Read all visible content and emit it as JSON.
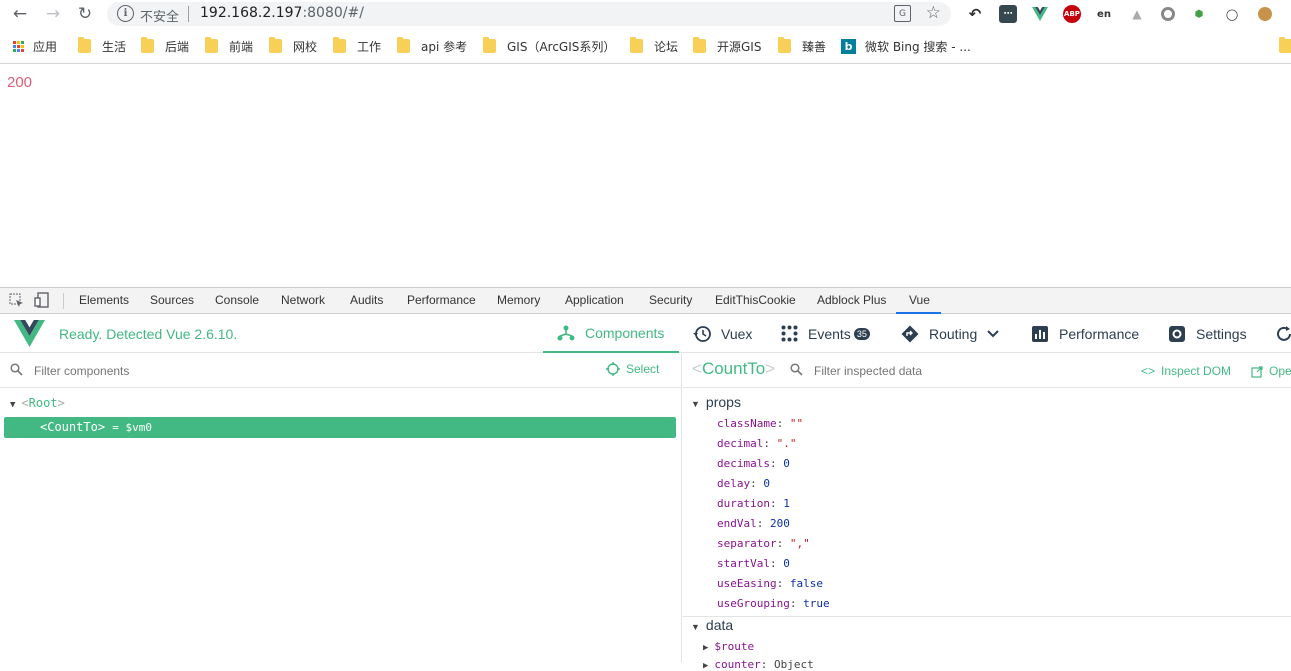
{
  "browser": {
    "security_label": "不安全",
    "url_host": "192.168.2.197",
    "url_rest": ":8080/#/",
    "bookmarks": [
      {
        "label": "应用",
        "kind": "apps"
      },
      {
        "label": "生活",
        "kind": "folder"
      },
      {
        "label": "后端",
        "kind": "folder"
      },
      {
        "label": "前端",
        "kind": "folder"
      },
      {
        "label": "网校",
        "kind": "folder"
      },
      {
        "label": "工作",
        "kind": "folder"
      },
      {
        "label": "api 参考",
        "kind": "folder"
      },
      {
        "label": "GIS（ArcGIS系列）",
        "kind": "folder"
      },
      {
        "label": "论坛",
        "kind": "folder"
      },
      {
        "label": "开源GIS",
        "kind": "folder"
      },
      {
        "label": "臻善",
        "kind": "folder"
      },
      {
        "label": "微软 Bing 搜索 - ...",
        "kind": "bing"
      }
    ],
    "extensions": [
      "undo-icon",
      "grid-icon",
      "vue-icon",
      "abp-icon",
      "en-icon",
      "tree-icon",
      "circle-icon",
      "nodejs-icon",
      "sync-icon",
      "cookie-icon"
    ],
    "ext_abp_text": "ABP"
  },
  "page": {
    "value": "200"
  },
  "devtools": {
    "tabs": [
      "Elements",
      "Sources",
      "Console",
      "Network",
      "Audits",
      "Performance",
      "Memory",
      "Application",
      "Security",
      "EditThisCookie",
      "Adblock Plus",
      "Vue"
    ],
    "active_tab": "Vue"
  },
  "vue": {
    "status": "Ready. Detected Vue 2.6.10.",
    "nav": {
      "components": "Components",
      "vuex": "Vuex",
      "events": "Events",
      "events_badge": "35",
      "routing": "Routing",
      "performance": "Performance",
      "settings": "Settings"
    },
    "filter_components_placeholder": "Filter components",
    "select_label": "Select",
    "tree": {
      "root": "Root",
      "child": "CountTo",
      "child_vm": "= $vm0"
    },
    "inspector": {
      "component_name": "CountTo",
      "filter_placeholder": "Filter inspected data",
      "inspect_dom": "Inspect DOM",
      "open_label": "Ope",
      "props_label": "props",
      "props": [
        {
          "key": "className",
          "value": "\"\"",
          "type": "str"
        },
        {
          "key": "decimal",
          "value": "\".\"",
          "type": "str"
        },
        {
          "key": "decimals",
          "value": "0",
          "type": "num"
        },
        {
          "key": "delay",
          "value": "0",
          "type": "num"
        },
        {
          "key": "duration",
          "value": "1",
          "type": "num"
        },
        {
          "key": "endVal",
          "value": "200",
          "type": "num"
        },
        {
          "key": "separator",
          "value": "\",\"",
          "type": "str"
        },
        {
          "key": "startVal",
          "value": "0",
          "type": "num"
        },
        {
          "key": "useEasing",
          "value": "false",
          "type": "bool"
        },
        {
          "key": "useGrouping",
          "value": "true",
          "type": "bool"
        }
      ],
      "data_label": "data",
      "data": [
        {
          "key": "$route",
          "value": ""
        },
        {
          "key": "counter",
          "value": "Object"
        }
      ]
    }
  },
  "colors": {
    "vue_green": "#42b983",
    "page_value": "#d95f7a"
  }
}
